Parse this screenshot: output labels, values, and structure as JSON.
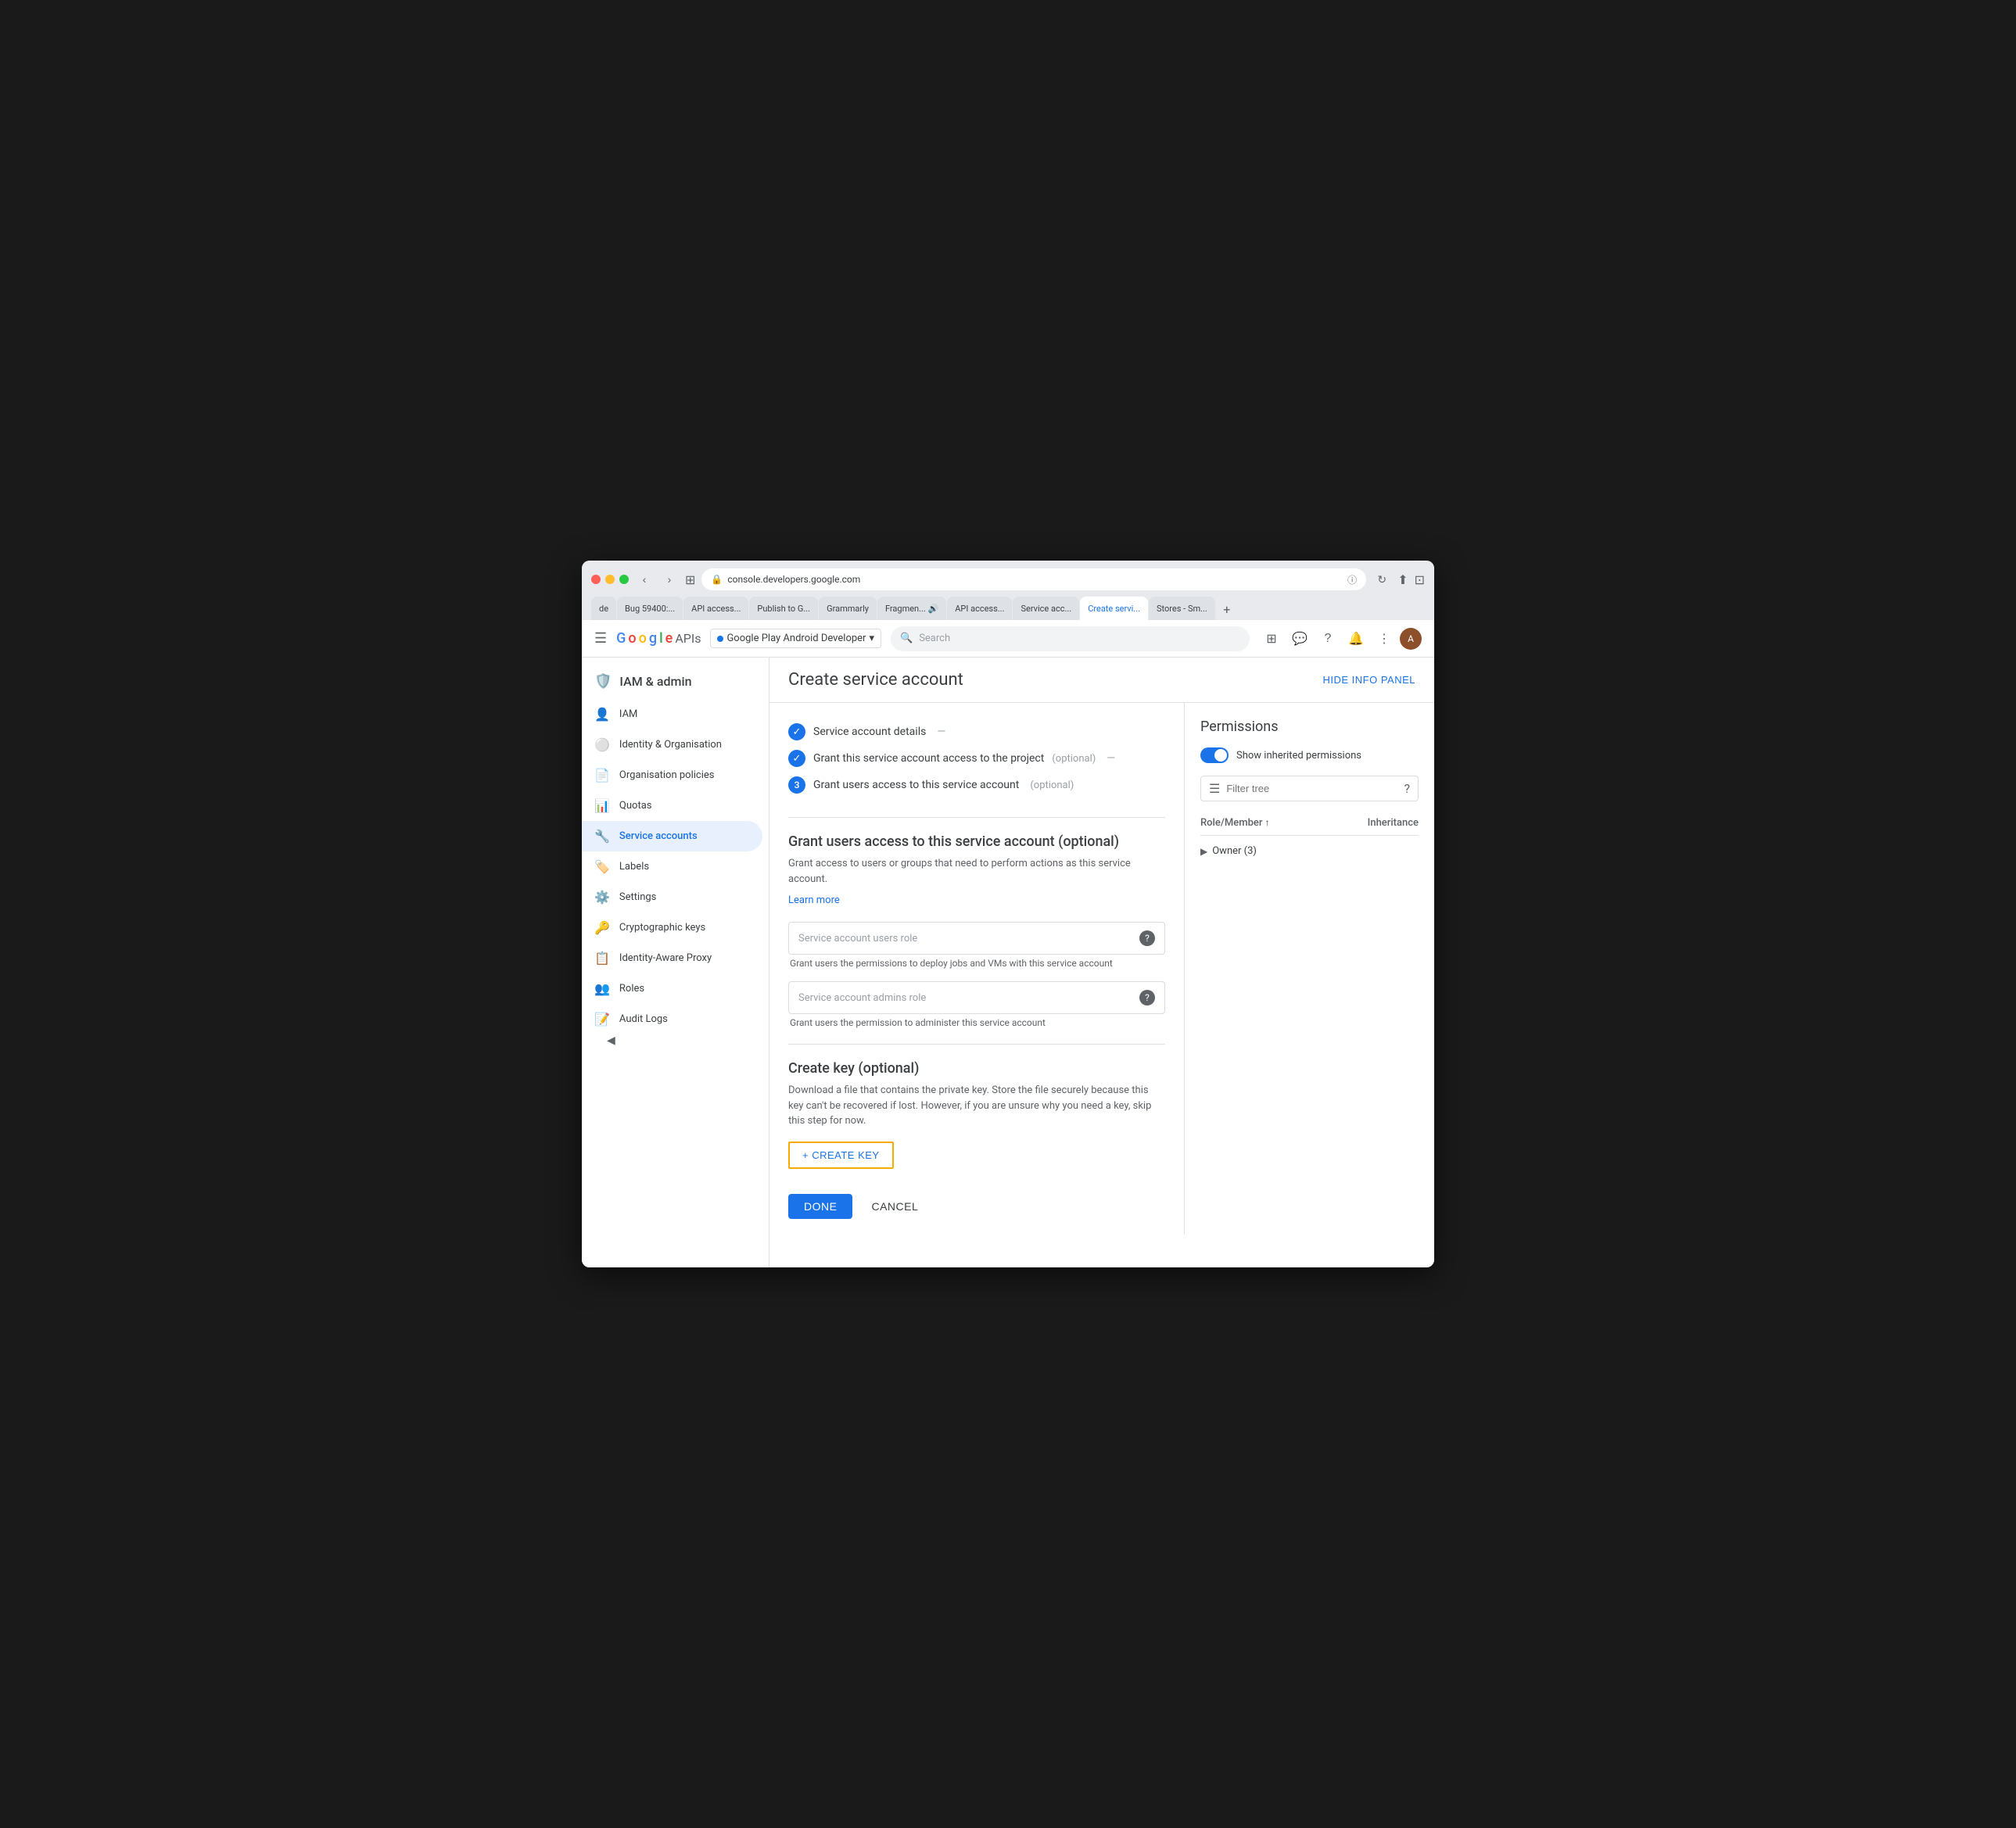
{
  "browser": {
    "url": "console.developers.google.com",
    "tabs": [
      {
        "label": "de",
        "active": false
      },
      {
        "label": "Bug 59400:...",
        "active": false
      },
      {
        "label": "API access...",
        "active": false
      },
      {
        "label": "Publish to G...",
        "active": false
      },
      {
        "label": "Grammarly",
        "active": false
      },
      {
        "label": "Fragmen...",
        "active": false
      },
      {
        "label": "API access...",
        "active": false
      },
      {
        "label": "Service acc...",
        "active": false
      },
      {
        "label": "Create servi...",
        "active": true
      },
      {
        "label": "Stores - Sm...",
        "active": false
      }
    ]
  },
  "header": {
    "menu_icon": "☰",
    "logo_g": "G",
    "logo_oogle": "oogle",
    "logo_apis": "APIs",
    "project_name": "Google Play Android Developer",
    "search_placeholder": "Search",
    "hide_panel_label": "HIDE INFO PANEL"
  },
  "sidebar": {
    "title": "IAM & admin",
    "title_icon": "shield",
    "items": [
      {
        "label": "IAM",
        "icon": "👤",
        "active": false
      },
      {
        "label": "Identity & Organisation",
        "icon": "🔵",
        "active": false
      },
      {
        "label": "Organisation policies",
        "icon": "📄",
        "active": false
      },
      {
        "label": "Quotas",
        "icon": "📊",
        "active": false
      },
      {
        "label": "Service accounts",
        "icon": "🔧",
        "active": true
      },
      {
        "label": "Labels",
        "icon": "🏷️",
        "active": false
      },
      {
        "label": "Settings",
        "icon": "⚙️",
        "active": false
      },
      {
        "label": "Cryptographic keys",
        "icon": "🛡️",
        "active": false
      },
      {
        "label": "Identity-Aware Proxy",
        "icon": "📋",
        "active": false
      },
      {
        "label": "Roles",
        "icon": "👥",
        "active": false
      },
      {
        "label": "Audit Logs",
        "icon": "📝",
        "active": false
      }
    ],
    "collapse_icon": "◀"
  },
  "main": {
    "title": "Create service account",
    "steps": [
      {
        "num": "✓",
        "done": true,
        "label": "Service account details",
        "separator": "—",
        "optional": ""
      },
      {
        "num": "✓",
        "done": true,
        "label": "Grant this service account access to the project",
        "separator": "—",
        "optional": "(optional)"
      },
      {
        "num": "3",
        "done": false,
        "label": "Grant users access to this service account",
        "separator": "",
        "optional": "(optional)"
      }
    ],
    "section": {
      "title": "Grant users access to this service account (optional)",
      "description": "Grant access to users or groups that need to perform actions as this service account.",
      "learn_more": "Learn more",
      "users_role_placeholder": "Service account users role",
      "users_role_desc": "Grant users the permissions to deploy jobs and VMs with this service account",
      "admins_role_placeholder": "Service account admins role",
      "admins_role_desc": "Grant users the permission to administer this service account"
    },
    "create_key": {
      "title": "Create key (optional)",
      "description": "Download a file that contains the private key. Store the file securely because this key can't be recovered if lost. However, if you are unsure why you need a key, skip this step for now.",
      "button_label": "+ CREATE KEY"
    },
    "actions": {
      "done_label": "DONE",
      "cancel_label": "CANCEL"
    }
  },
  "permissions_panel": {
    "title": "Permissions",
    "toggle_label": "Show inherited permissions",
    "toggle_on": true,
    "filter_placeholder": "Filter tree",
    "table_header": {
      "role_member": "Role/Member",
      "sort_icon": "↑",
      "inheritance": "Inheritance"
    },
    "rows": [
      {
        "label": "Owner (3)",
        "expanded": false
      }
    ]
  }
}
